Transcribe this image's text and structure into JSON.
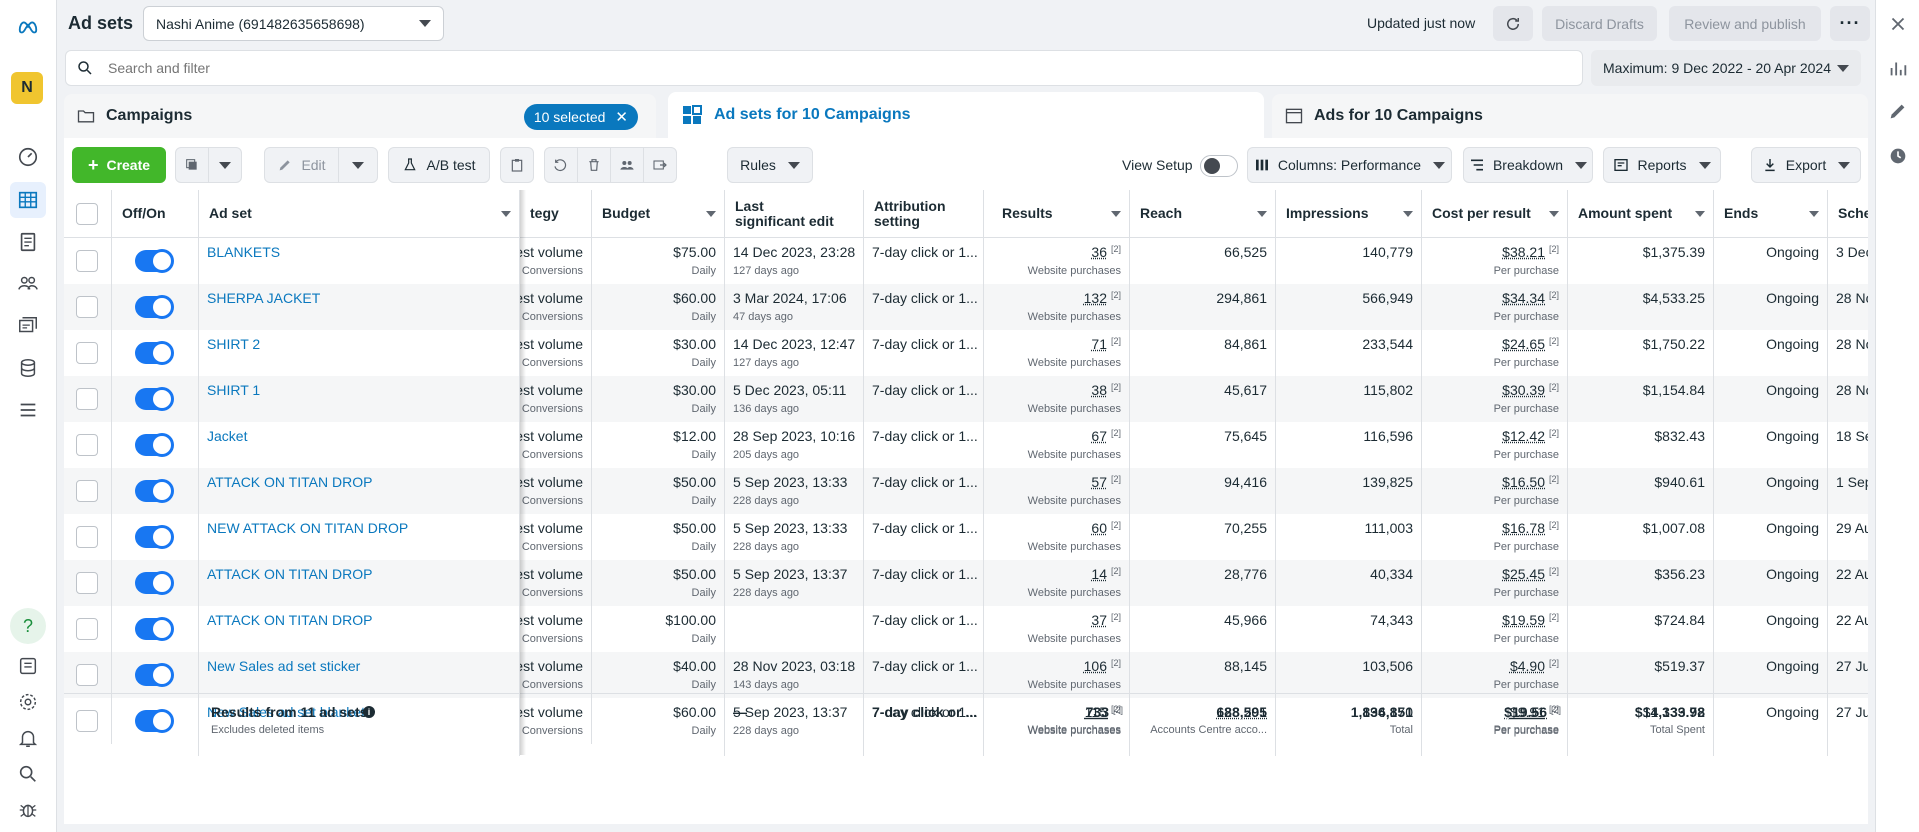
{
  "topbar": {
    "title": "Ad sets",
    "account": "Nashi Anime (691482635658698)",
    "updated": "Updated just now",
    "discard": "Discard Drafts",
    "review": "Review and publish"
  },
  "left_nav": {
    "avatar": "N",
    "icons": [
      "meta-logo-icon",
      "dashboard-icon",
      "table-icon",
      "pages-icon",
      "audience-icon",
      "ads-icon",
      "database-icon",
      "menu-icon",
      "help-icon",
      "pages-alt-icon",
      "settings-icon",
      "bell-icon",
      "search-icon",
      "bug-icon"
    ]
  },
  "search": {
    "placeholder": "Search and filter"
  },
  "date_range": "Maximum: 9 Dec 2022 - 20 Apr 2024",
  "tabs": {
    "campaigns": "Campaigns",
    "selected": "10 selected",
    "adsets": "Ad sets for 10 Campaigns",
    "ads": "Ads for 10 Campaigns"
  },
  "toolbar": {
    "create": "Create",
    "edit": "Edit",
    "ab_test": "A/B test",
    "rules": "Rules",
    "view_setup": "View Setup",
    "columns": "Columns: Performance",
    "breakdown": "Breakdown",
    "reports": "Reports",
    "export": "Export"
  },
  "columns": {
    "offon": "Off/On",
    "adset": "Ad set",
    "strategy": "tegy",
    "budget": "Budget",
    "last_edit": "Last significant edit",
    "attribution": "Attribution setting",
    "results": "Results",
    "reach": "Reach",
    "impressions": "Impressions",
    "cpr": "Cost per result",
    "spent": "Amount spent",
    "ends": "Ends",
    "schedule": "Sche"
  },
  "rows": [
    {
      "name": "BLANKETS",
      "strategy": "est volume",
      "strategy_sub": "Conversions",
      "budget": "$75.00",
      "budget_sub": "Daily",
      "edit": "14 Dec 2023, 23:28",
      "edit_sub": "127 days ago",
      "attr": "7-day click or 1...",
      "results": "36",
      "results_sub": "Website purchases",
      "reach": "66,525",
      "impr": "140,779",
      "cpr": "$38.21",
      "cpr_sub": "Per purchase",
      "spent": "$1,375.39",
      "ends": "Ongoing",
      "sched": "3 Dec"
    },
    {
      "name": "SHERPA JACKET",
      "strategy": "est volume",
      "strategy_sub": "Conversions",
      "budget": "$60.00",
      "budget_sub": "Daily",
      "edit": "3 Mar 2024, 17:06",
      "edit_sub": "47 days ago",
      "attr": "7-day click or 1...",
      "results": "132",
      "results_sub": "Website purchases",
      "reach": "294,861",
      "impr": "566,949",
      "cpr": "$34.34",
      "cpr_sub": "Per purchase",
      "spent": "$4,533.25",
      "ends": "Ongoing",
      "sched": "28 No"
    },
    {
      "name": "SHIRT 2",
      "strategy": "est volume",
      "strategy_sub": "Conversions",
      "budget": "$30.00",
      "budget_sub": "Daily",
      "edit": "14 Dec 2023, 12:47",
      "edit_sub": "127 days ago",
      "attr": "7-day click or 1...",
      "results": "71",
      "results_sub": "Website purchases",
      "reach": "84,861",
      "impr": "233,544",
      "cpr": "$24.65",
      "cpr_sub": "Per purchase",
      "spent": "$1,750.22",
      "ends": "Ongoing",
      "sched": "28 No"
    },
    {
      "name": "SHIRT 1",
      "strategy": "est volume",
      "strategy_sub": "Conversions",
      "budget": "$30.00",
      "budget_sub": "Daily",
      "edit": "5 Dec 2023, 05:11",
      "edit_sub": "136 days ago",
      "attr": "7-day click or 1...",
      "results": "38",
      "results_sub": "Website purchases",
      "reach": "45,617",
      "impr": "115,802",
      "cpr": "$30.39",
      "cpr_sub": "Per purchase",
      "spent": "$1,154.84",
      "ends": "Ongoing",
      "sched": "28 No"
    },
    {
      "name": "Jacket",
      "strategy": "est volume",
      "strategy_sub": "Conversions",
      "budget": "$12.00",
      "budget_sub": "Daily",
      "edit": "28 Sep 2023, 10:16",
      "edit_sub": "205 days ago",
      "attr": "7-day click or 1...",
      "results": "67",
      "results_sub": "Website purchases",
      "reach": "75,645",
      "impr": "116,596",
      "cpr": "$12.42",
      "cpr_sub": "Per purchase",
      "spent": "$832.43",
      "ends": "Ongoing",
      "sched": "18 Se"
    },
    {
      "name": "ATTACK ON TITAN DROP",
      "strategy": "est volume",
      "strategy_sub": "Conversions",
      "budget": "$50.00",
      "budget_sub": "Daily",
      "edit": "5 Sep 2023, 13:33",
      "edit_sub": "228 days ago",
      "attr": "7-day click or 1...",
      "results": "57",
      "results_sub": "Website purchases",
      "reach": "94,416",
      "impr": "139,825",
      "cpr": "$16.50",
      "cpr_sub": "Per purchase",
      "spent": "$940.61",
      "ends": "Ongoing",
      "sched": "1 Sep"
    },
    {
      "name": "NEW ATTACK ON TITAN DROP",
      "strategy": "est volume",
      "strategy_sub": "Conversions",
      "budget": "$50.00",
      "budget_sub": "Daily",
      "edit": "5 Sep 2023, 13:33",
      "edit_sub": "228 days ago",
      "attr": "7-day click or 1...",
      "results": "60",
      "results_sub": "Website purchases",
      "reach": "70,255",
      "impr": "111,003",
      "cpr": "$16.78",
      "cpr_sub": "Per purchase",
      "spent": "$1,007.08",
      "ends": "Ongoing",
      "sched": "29 Au"
    },
    {
      "name": "ATTACK ON TITAN DROP",
      "strategy": "est volume",
      "strategy_sub": "Conversions",
      "budget": "$50.00",
      "budget_sub": "Daily",
      "edit": "5 Sep 2023, 13:37",
      "edit_sub": "228 days ago",
      "attr": "7-day click or 1...",
      "results": "14",
      "results_sub": "Website purchases",
      "reach": "28,776",
      "impr": "40,334",
      "cpr": "$25.45",
      "cpr_sub": "Per purchase",
      "spent": "$356.23",
      "ends": "Ongoing",
      "sched": "22 Au"
    },
    {
      "name": "ATTACK ON TITAN DROP",
      "strategy": "est volume",
      "strategy_sub": "Conversions",
      "budget": "$100.00",
      "budget_sub": "Daily",
      "edit": "",
      "edit_sub": "",
      "attr": "7-day click or 1...",
      "results": "37",
      "results_sub": "Website purchases",
      "reach": "45,966",
      "impr": "74,343",
      "cpr": "$19.59",
      "cpr_sub": "Per purchase",
      "spent": "$724.84",
      "ends": "Ongoing",
      "sched": "22 Au"
    },
    {
      "name": "New Sales ad set sticker",
      "strategy": "est volume",
      "strategy_sub": "Conversions",
      "budget": "$40.00",
      "budget_sub": "Daily",
      "edit": "28 Nov 2023, 03:18",
      "edit_sub": "143 days ago",
      "attr": "7-day click or 1...",
      "results": "106",
      "results_sub": "Website purchases",
      "reach": "88,145",
      "impr": "103,506",
      "cpr": "$4.90",
      "cpr_sub": "Per purchase",
      "spent": "$519.37",
      "ends": "Ongoing",
      "sched": "27 Ju"
    },
    {
      "name": "New Sales ad set blankets",
      "strategy": "est volume",
      "strategy_sub": "Conversions",
      "budget": "$60.00",
      "budget_sub": "Daily",
      "edit": "5 Sep 2023, 13:37",
      "edit_sub": "228 days ago",
      "attr": "7-day click or 1...",
      "results": "115",
      "results_sub": "Website purchases",
      "reach": "123,201",
      "impr": "194,170",
      "cpr": "$9.91",
      "cpr_sub": "Per purchase",
      "spent": "$1,139.72",
      "ends": "Ongoing",
      "sched": "27 Ju"
    }
  ],
  "totals": {
    "label": "Results from 11 ad sets",
    "label_sub": "Excludes deleted items",
    "edit": "—",
    "attr": "7-day click or ...",
    "results": "733",
    "results_sub": "Website purchases",
    "reach": "688,595",
    "reach_sub": "Accounts Centre acco...",
    "impr": "1,836,851",
    "impr_sub": "Total",
    "cpr": "$19.56",
    "cpr_sub": "Per purchase",
    "spent": "$14,333.98",
    "spent_sub": "Total Spent"
  },
  "colors": {
    "accent": "#0a78be",
    "create": "#42b72a",
    "toggle_on": "#1877f2"
  }
}
